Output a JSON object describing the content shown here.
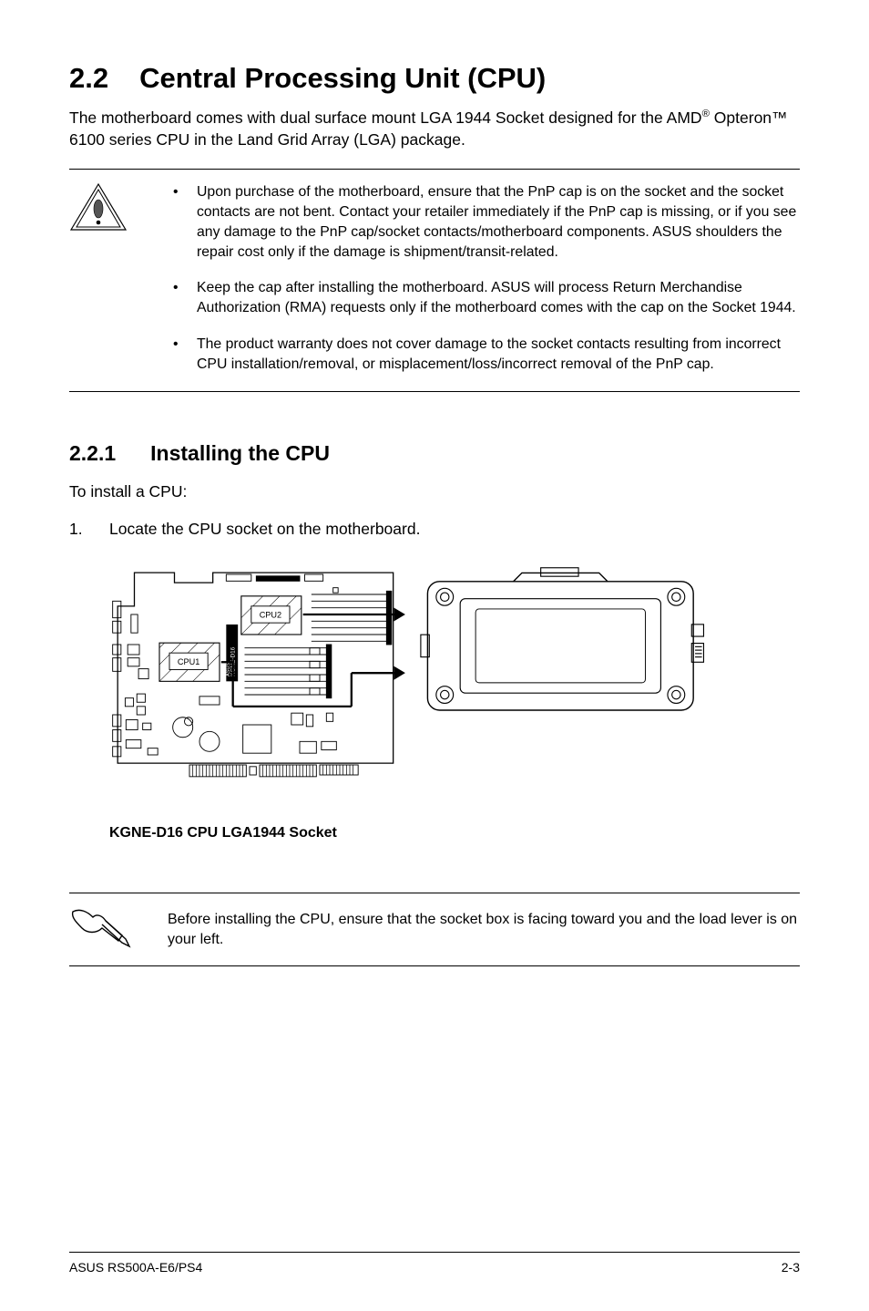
{
  "section_number": "2.2",
  "section_title": "Central Processing Unit (CPU)",
  "intro_before_sup": "The motherboard comes with dual surface mount LGA 1944 Socket designed for the AMD",
  "intro_sup": "®",
  "intro_after_sup": " Opteron™ 6100 series CPU in the Land Grid Array (LGA) package.",
  "warning_items": [
    "Upon purchase of the motherboard, ensure that the PnP cap is on the socket and the socket contacts are not bent. Contact your retailer immediately if the PnP cap is missing, or if you see any damage to the PnP cap/socket contacts/motherboard components. ASUS shoulders the repair cost only if the damage is shipment/transit-related.",
    "Keep the cap after installing the motherboard. ASUS will process Return Merchandise Authorization (RMA) requests only if the motherboard comes with the cap on the Socket 1944.",
    "The product warranty does not cover damage to the socket contacts resulting from incorrect CPU installation/removal, or misplacement/loss/incorrect removal of the PnP cap."
  ],
  "subsection_number": "2.2.1",
  "subsection_title": "Installing the CPU",
  "subsection_intro": "To install a CPU:",
  "step1_number": "1.",
  "step1_text": "Locate the CPU socket on the motherboard.",
  "board_labels": {
    "cpu1": "CPU1",
    "cpu2": "CPU2",
    "side": "KGNE-D16",
    "asus": "ASUS"
  },
  "figure_caption": "KGNE-D16 CPU LGA1944 Socket",
  "note2_text": "Before installing the CPU, ensure that the socket box is facing toward you and the load lever is on your left.",
  "footer_left": "ASUS RS500A-E6/PS4",
  "footer_right": "2-3"
}
